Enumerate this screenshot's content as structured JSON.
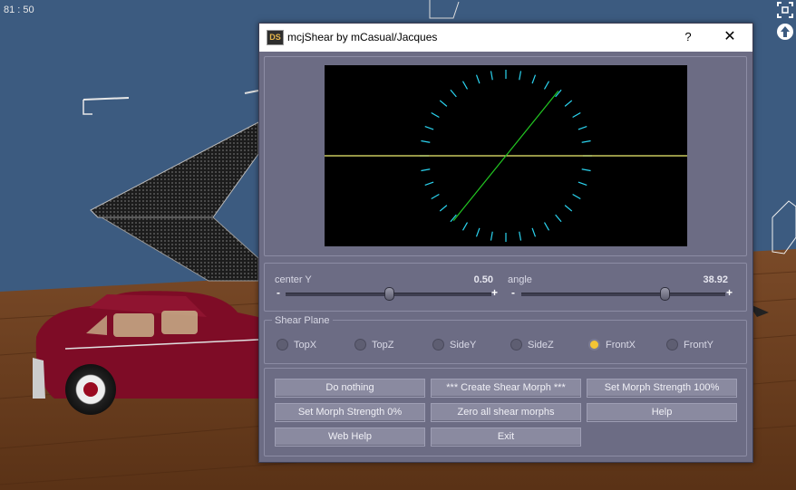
{
  "viewport": {
    "fps": "81 : 50",
    "colors": {
      "wall": "#3c5b80",
      "floor": "#6b3f22",
      "car": "#7e0c26",
      "ramp": "#1e1e1e"
    }
  },
  "dialog": {
    "app_icon": "DS",
    "title": "mcjShear by mCasual/Jacques",
    "help_symbol": "?",
    "close_symbol": "✕",
    "preview": {
      "center_y": 0.5,
      "angle_deg": 38.92,
      "tick_color": "#2bd4f0",
      "line_color": "#f0f070",
      "shear_color": "#22c822"
    },
    "sliders": {
      "center_y": {
        "label": "center Y",
        "value": "0.50",
        "fraction": 0.5,
        "minus": "-",
        "plus": "+"
      },
      "angle": {
        "label": "angle",
        "value": "38.92",
        "fraction": 0.7,
        "minus": "-",
        "plus": "+"
      }
    },
    "shear_plane": {
      "title": "Shear Plane",
      "options": [
        "TopX",
        "TopZ",
        "SideY",
        "SideZ",
        "FrontX",
        "FrontY"
      ],
      "selected": "FrontX",
      "selected_color": "#f4c534"
    },
    "buttons": [
      "Do nothing",
      "*** Create Shear Morph ***",
      "Set Morph Strength 100%",
      "Set Morph Strength 0%",
      "Zero all shear morphs",
      "Help",
      "Web Help",
      "Exit"
    ]
  }
}
